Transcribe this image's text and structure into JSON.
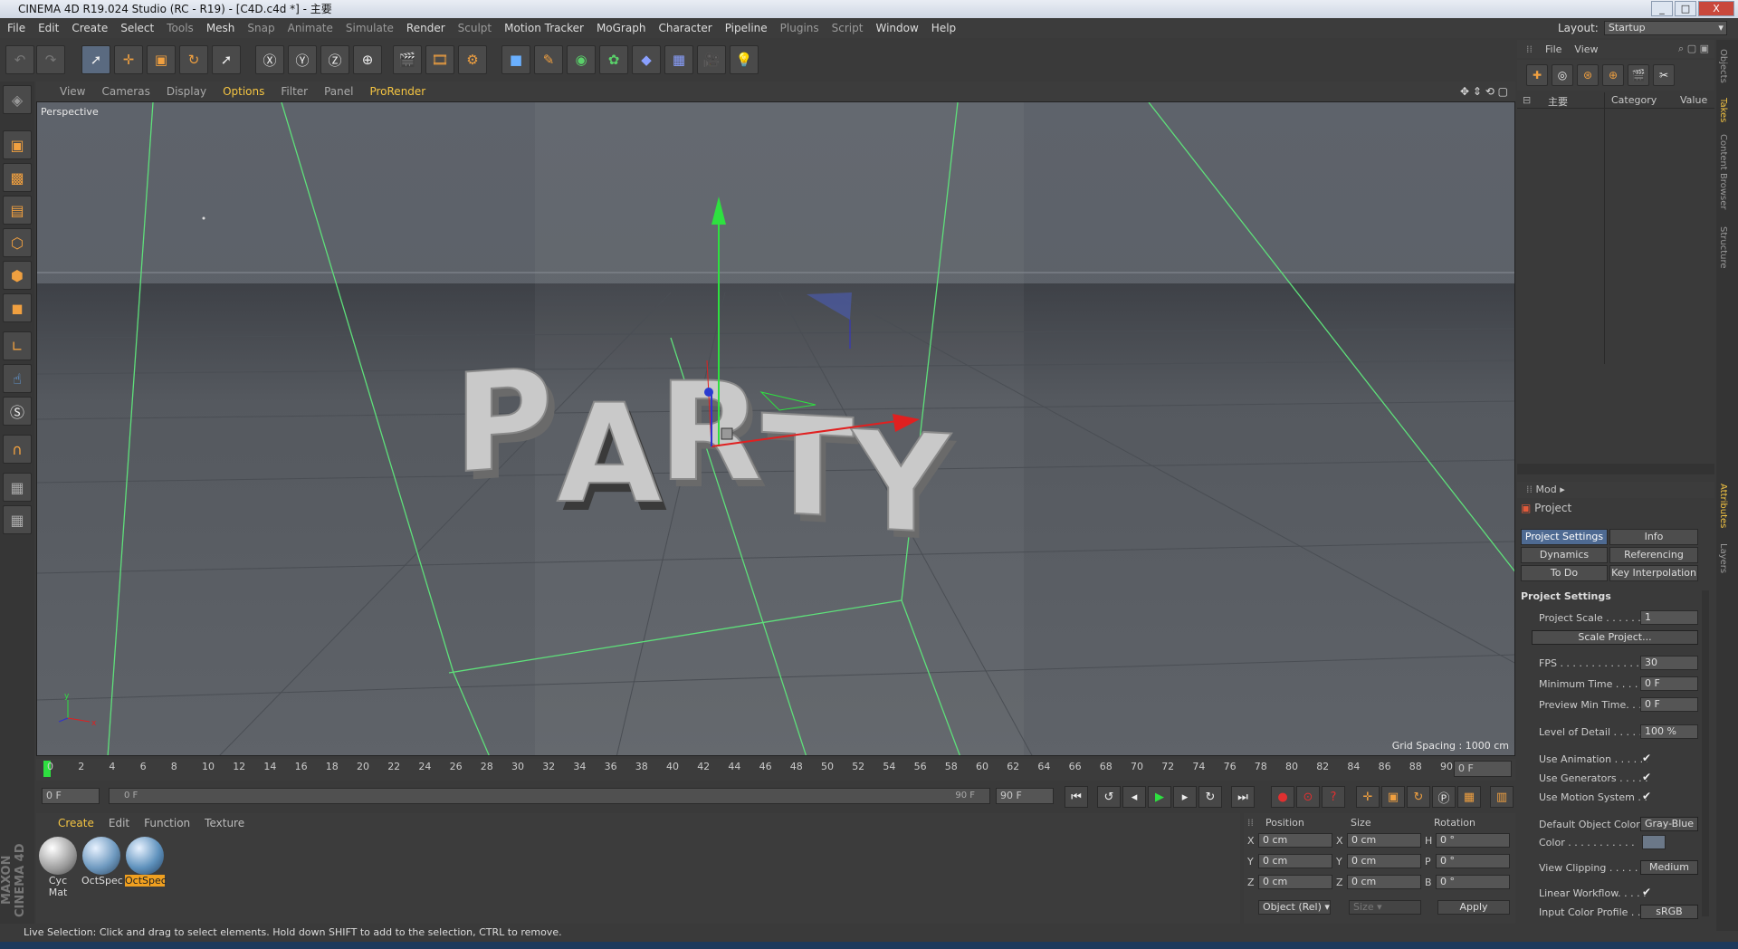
{
  "window": {
    "title": "CINEMA 4D R19.024 Studio (RC - R19) - [C4D.c4d *] - 主要",
    "min": "_",
    "max": "□",
    "close": "X"
  },
  "menu": {
    "items": [
      "File",
      "Edit",
      "Create",
      "Select",
      "Tools",
      "Mesh",
      "Snap",
      "Animate",
      "Simulate",
      "Render",
      "Sculpt",
      "Motion Tracker",
      "MoGraph",
      "Character",
      "Pipeline",
      "Plugins",
      "Script",
      "Window",
      "Help"
    ],
    "layout_label": "Layout:",
    "layout_value": "Startup"
  },
  "viewport": {
    "menu": [
      "View",
      "Cameras",
      "Display",
      "Options",
      "Filter",
      "Panel",
      "ProRender"
    ],
    "label": "Perspective",
    "grid_spacing": "Grid Spacing : 1000 cm",
    "text3d": "PARTY"
  },
  "timeline": {
    "ticks": [
      "0",
      "2",
      "4",
      "6",
      "8",
      "10",
      "12",
      "14",
      "16",
      "18",
      "20",
      "22",
      "24",
      "26",
      "28",
      "30",
      "32",
      "34",
      "36",
      "38",
      "40",
      "42",
      "44",
      "46",
      "48",
      "50",
      "52",
      "54",
      "56",
      "58",
      "60",
      "62",
      "64",
      "66",
      "68",
      "70",
      "72",
      "74",
      "76",
      "78",
      "80",
      "82",
      "84",
      "86",
      "88",
      "90"
    ],
    "current": "0 F",
    "start": "0 F",
    "range_start": "0 F",
    "range_end": "90 F",
    "end": "90 F"
  },
  "materials": {
    "tabs": [
      "Create",
      "Edit",
      "Function",
      "Texture"
    ],
    "items": [
      {
        "name": "Cyc Mat",
        "color": "#cfcfcf"
      },
      {
        "name": "OctSpec",
        "color": "#7fa8c8"
      },
      {
        "name": "OctSpec",
        "color": "#6a9cc4",
        "selected": true
      }
    ]
  },
  "coords": {
    "headers": [
      "Position",
      "Size",
      "Rotation"
    ],
    "rows": [
      {
        "axis": "X",
        "pos": "0 cm",
        "saxis": "X",
        "size": "0 cm",
        "raxis": "H",
        "rot": "0 °"
      },
      {
        "axis": "Y",
        "pos": "0 cm",
        "saxis": "Y",
        "size": "0 cm",
        "raxis": "P",
        "rot": "0 °"
      },
      {
        "axis": "Z",
        "pos": "0 cm",
        "saxis": "Z",
        "size": "0 cm",
        "raxis": "B",
        "rot": "0 °"
      }
    ],
    "mode": "Object (Rel)",
    "size_mode": "Size",
    "apply": "Apply"
  },
  "status": "Live Selection: Click and drag to select elements. Hold down SHIFT to add to the selection, CTRL to remove.",
  "objects_panel": {
    "menu": [
      "File",
      "View"
    ],
    "root_item": "主要",
    "columns": [
      "Category",
      "Value"
    ]
  },
  "attributes": {
    "mode": "Mod",
    "header": "Project",
    "tabs": [
      "Project Settings",
      "Info",
      "Dynamics",
      "Referencing",
      "To Do",
      "Key Interpolation"
    ],
    "section": "Project Settings",
    "rows": [
      {
        "label": "Project Scale . . . . . . .",
        "value": "1"
      },
      {
        "label": "FPS . . . . . . . . . . . . . .",
        "value": "30"
      },
      {
        "label": "Minimum Time . . . . .",
        "value": "0 F"
      },
      {
        "label": "Preview Min Time. . . .",
        "value": "0 F"
      },
      {
        "label": "Level of Detail . . . . . .",
        "value": "100 %"
      }
    ],
    "scale_button": "Scale Project...",
    "checks": [
      "Use Animation . . . . . . .",
      "Use Generators . . . . . .",
      "Use Motion System . . ."
    ],
    "default_color_label": "Default Object Color",
    "default_color_value": "Gray-Blue",
    "color_label": "Color . . . . . . . . . . .",
    "view_clipping_label": "View Clipping . . . . . . .",
    "view_clipping_value": "Medium",
    "linear_workflow": "Linear Workflow. . . . .",
    "input_profile_label": "Input Color Profile . . .",
    "input_profile_value": "sRGB"
  },
  "side_tabs": [
    "Objects",
    "Takes",
    "Content Browser",
    "Structure",
    "Attributes",
    "Layers"
  ]
}
